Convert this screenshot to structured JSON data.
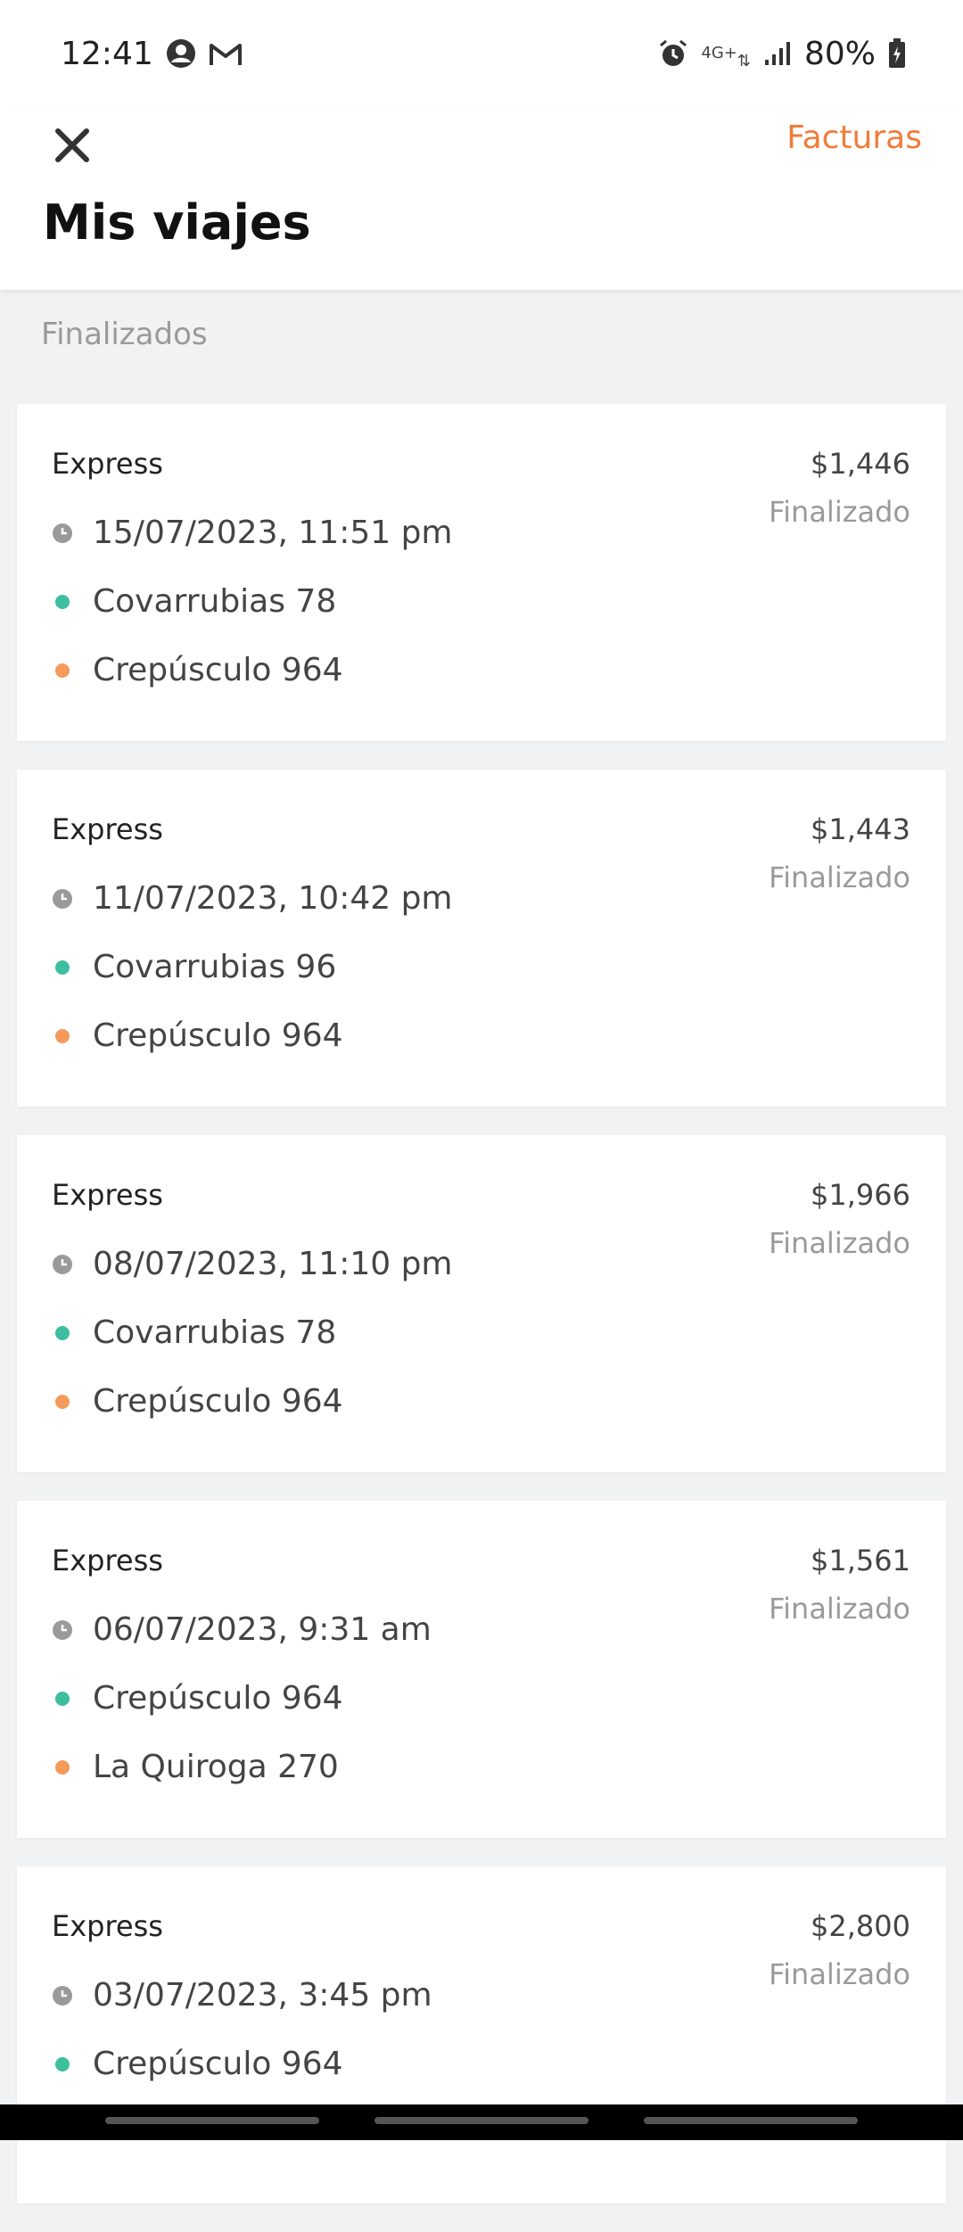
{
  "status_bar": {
    "time": "12:41",
    "network": "4G+",
    "battery": "80%",
    "icons": [
      "account-circle-icon",
      "gmail-icon",
      "alarm-icon",
      "network-arrows-icon",
      "signal-icon",
      "battery-charging-icon"
    ]
  },
  "header": {
    "close_icon": "close-icon",
    "invoices_label": "Facturas",
    "title": "Mis viajes"
  },
  "section": {
    "label": "Finalizados"
  },
  "trips": [
    {
      "service": "Express",
      "price": "$1,446",
      "status": "Finalizado",
      "datetime": "15/07/2023, 11:51 pm",
      "origin": "Covarrubias 78",
      "destination": "Crepúsculo 964"
    },
    {
      "service": "Express",
      "price": "$1,443",
      "status": "Finalizado",
      "datetime": "11/07/2023, 10:42 pm",
      "origin": "Covarrubias 96",
      "destination": "Crepúsculo 964"
    },
    {
      "service": "Express",
      "price": "$1,966",
      "status": "Finalizado",
      "datetime": "08/07/2023, 11:10 pm",
      "origin": "Covarrubias 78",
      "destination": "Crepúsculo 964"
    },
    {
      "service": "Express",
      "price": "$1,561",
      "status": "Finalizado",
      "datetime": "06/07/2023, 9:31 am",
      "origin": "Crepúsculo 964",
      "destination": "La Quiroga 270"
    },
    {
      "service": "Express",
      "price": "$2,800",
      "status": "Finalizado",
      "datetime": "03/07/2023, 3:45 pm",
      "origin": "Crepúsculo 964",
      "destination": ""
    }
  ],
  "colors": {
    "accent": "#f07c3a",
    "origin_dot": "#3dbf9f",
    "destination_dot": "#f59a5b",
    "clock_icon": "#9a9a9a"
  }
}
